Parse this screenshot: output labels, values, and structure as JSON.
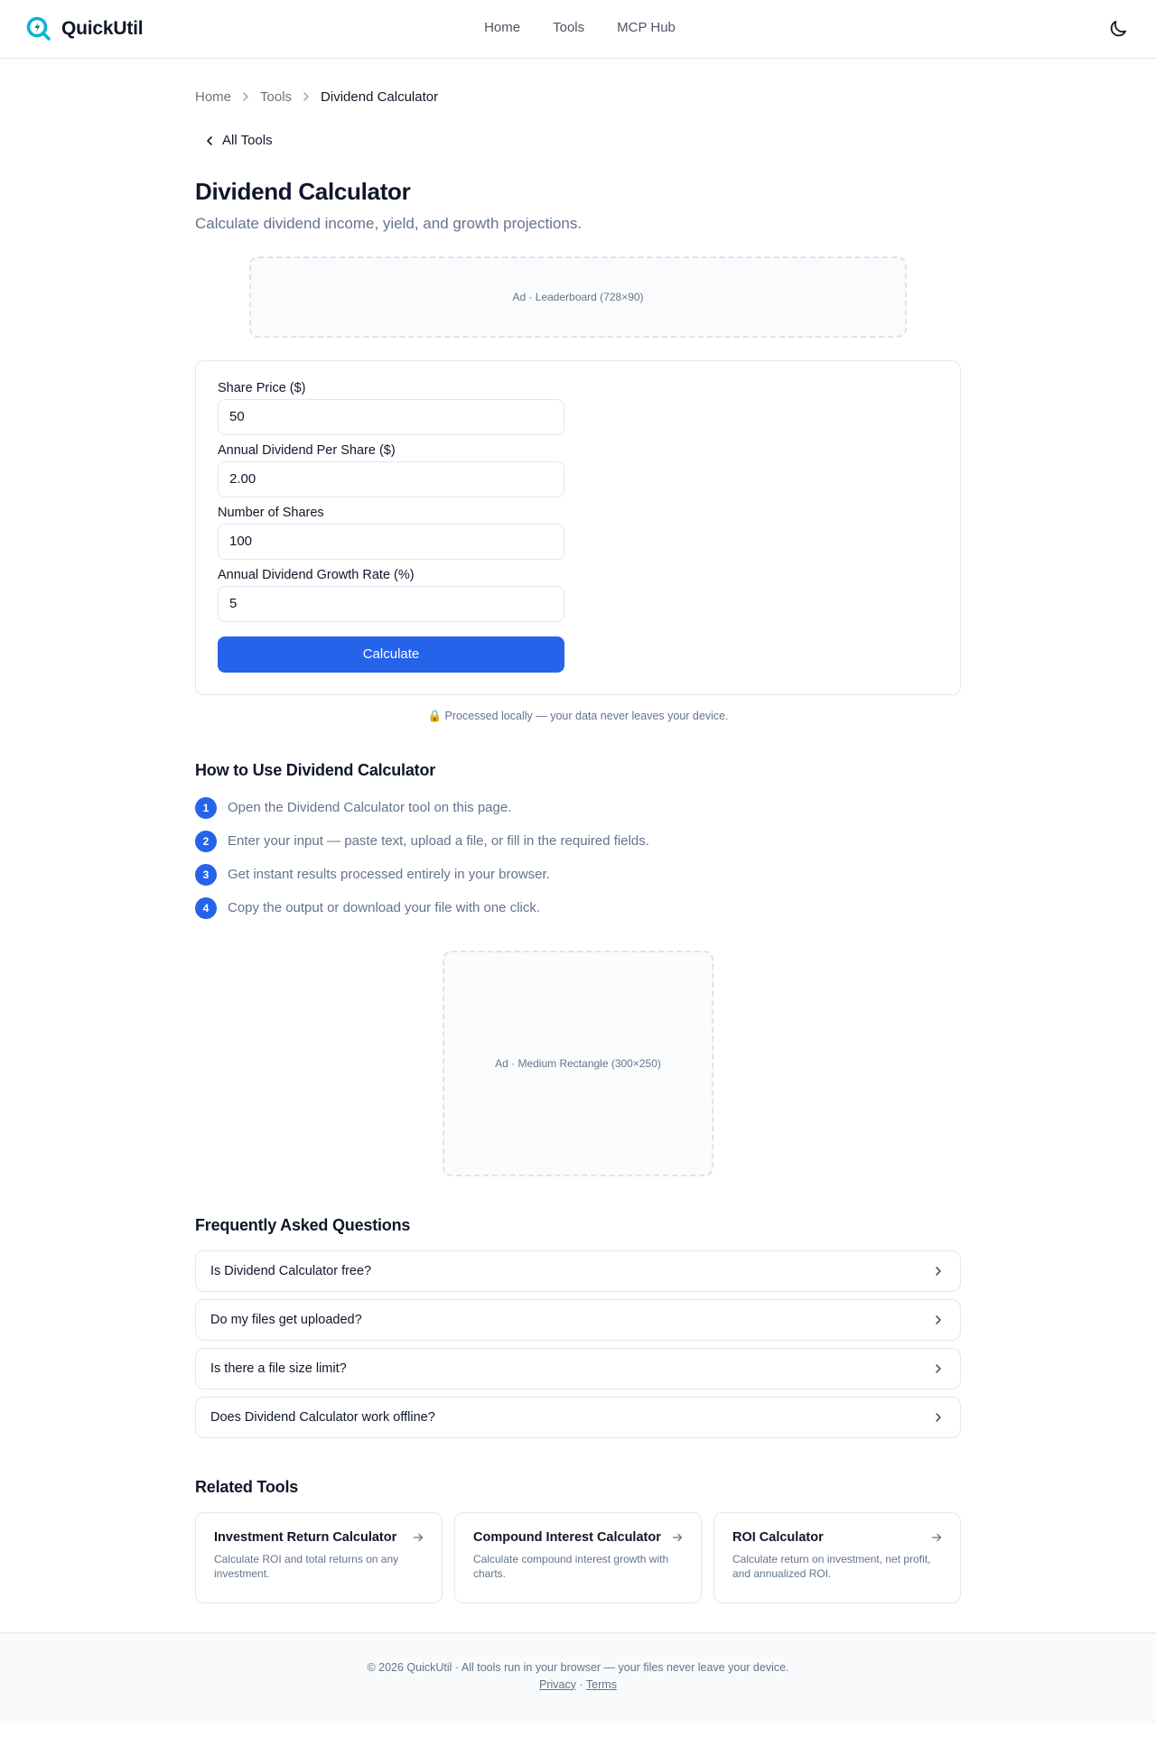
{
  "header": {
    "brand": "QuickUtil",
    "nav": [
      "Home",
      "Tools",
      "MCP Hub"
    ],
    "icons": {
      "logo": "quickutil-logo-icon",
      "theme": "moon-icon"
    }
  },
  "breadcrumb": {
    "items": [
      "Home",
      "Tools"
    ],
    "current": "Dividend Calculator"
  },
  "back_link": "All Tools",
  "page": {
    "title": "Dividend Calculator",
    "subtitle": "Calculate dividend income, yield, and growth projections."
  },
  "ads": {
    "leaderboard": "Ad · Leaderboard (728×90)",
    "rectangle": "Ad · Medium Rectangle (300×250)"
  },
  "form": {
    "fields": [
      {
        "label": "Share Price ($)",
        "value": "50"
      },
      {
        "label": "Annual Dividend Per Share ($)",
        "value": "2.00"
      },
      {
        "label": "Number of Shares",
        "value": "100"
      },
      {
        "label": "Annual Dividend Growth Rate (%)",
        "value": "5"
      }
    ],
    "submit": "Calculate"
  },
  "privacy_note": "🔒 Processed locally — your data never leaves your device.",
  "howto": {
    "title": "How to Use Dividend Calculator",
    "steps": [
      {
        "num": "1",
        "text": "Open the Dividend Calculator tool on this page."
      },
      {
        "num": "2",
        "text": "Enter your input — paste text, upload a file, or fill in the required fields."
      },
      {
        "num": "3",
        "text": "Get instant results processed entirely in your browser."
      },
      {
        "num": "4",
        "text": "Copy the output or download your file with one click."
      }
    ]
  },
  "faq": {
    "title": "Frequently Asked Questions",
    "items": [
      "Is Dividend Calculator free?",
      "Do my files get uploaded?",
      "Is there a file size limit?",
      "Does Dividend Calculator work offline?"
    ]
  },
  "related": {
    "title": "Related Tools",
    "tools": [
      {
        "name": "Investment Return Calculator",
        "desc": "Calculate ROI and total returns on any investment."
      },
      {
        "name": "Compound Interest Calculator",
        "desc": "Calculate compound interest growth with charts."
      },
      {
        "name": "ROI Calculator",
        "desc": "Calculate return on investment, net profit, and annualized ROI."
      }
    ]
  },
  "footer": {
    "text": "© 2026 QuickUtil · All tools run in your browser — your files never leave your device.",
    "links": [
      "Privacy",
      "Terms"
    ],
    "separator": "·"
  },
  "colors": {
    "accent": "#2563eb",
    "logo": "#06b6d4",
    "border": "#e5e7eb",
    "muted": "#64748b"
  }
}
